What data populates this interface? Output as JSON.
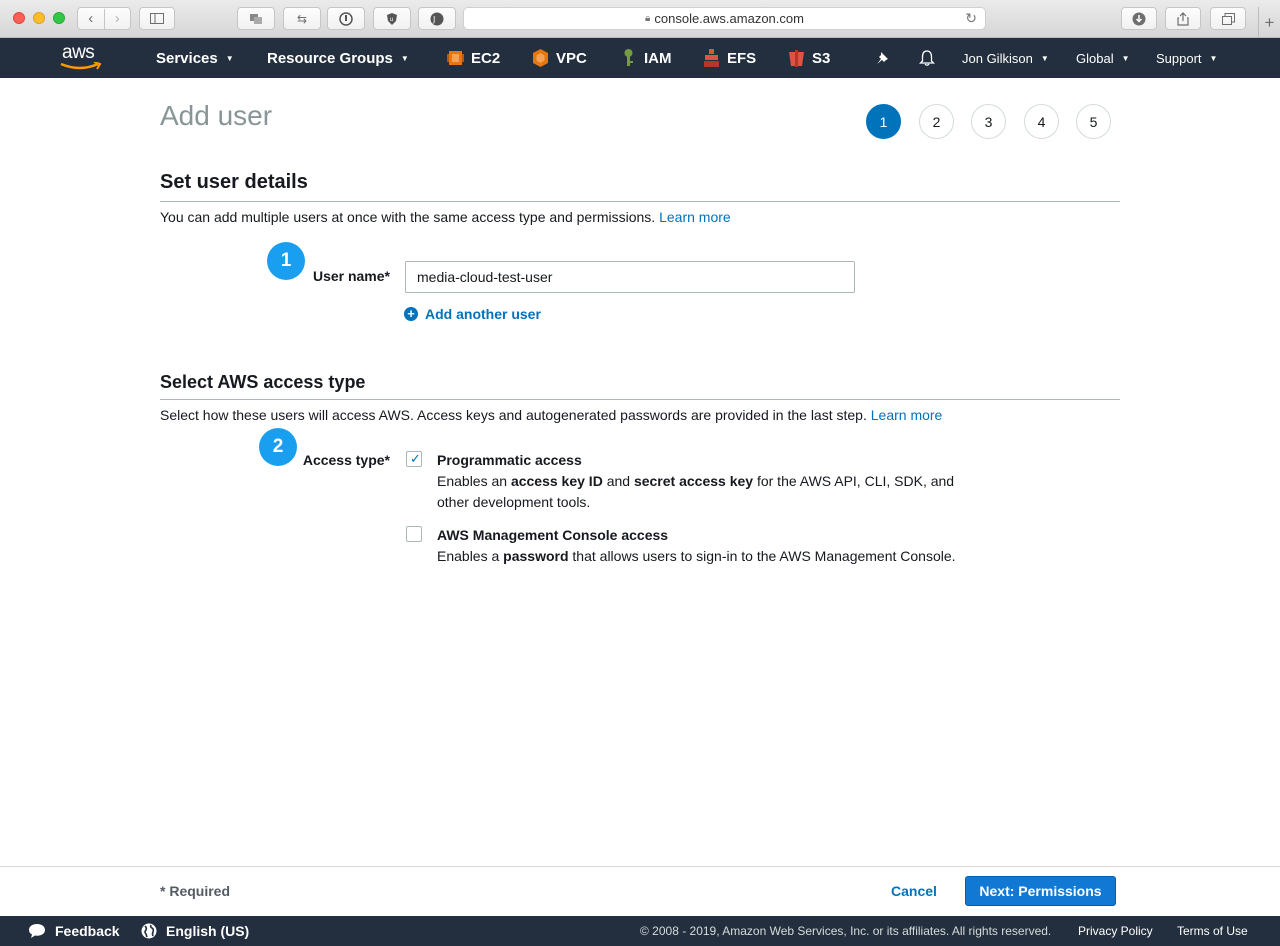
{
  "browser": {
    "url": "console.aws.amazon.com",
    "back_icon": "chevron-left-icon",
    "forward_icon": "chevron-right-icon"
  },
  "nav": {
    "logo": "aws",
    "services": "Services",
    "resource_groups": "Resource Groups",
    "shortcuts": [
      {
        "label": "EC2",
        "color": "#e8760f"
      },
      {
        "label": "VPC",
        "color": "#e8760f"
      },
      {
        "label": "IAM",
        "color": "#759c3e"
      },
      {
        "label": "EFS",
        "color": "#e05243"
      },
      {
        "label": "S3",
        "color": "#e05243"
      }
    ],
    "user": "Jon Gilkison",
    "region": "Global",
    "support": "Support"
  },
  "page": {
    "title": "Add user",
    "steps": [
      "1",
      "2",
      "3",
      "4",
      "5"
    ],
    "active_step": "1"
  },
  "details": {
    "title": "Set user details",
    "description": "You can add multiple users at once with the same access type and permissions.",
    "learn_more": "Learn more",
    "badge": "1",
    "user_name_label": "User name*",
    "user_name_value": "media-cloud-test-user",
    "add_another": "Add another user"
  },
  "access": {
    "title": "Select AWS access type",
    "description": "Select how these users will access AWS. Access keys and autogenerated passwords are provided in the last step.",
    "learn_more": "Learn more",
    "badge": "2",
    "access_type_label": "Access type*",
    "programmatic": {
      "title": "Programmatic access",
      "checked": true,
      "desc_a": "Enables an ",
      "desc_b": "access key ID",
      "desc_c": " and ",
      "desc_d": "secret access key",
      "desc_e": " for the AWS API, CLI, SDK, and other development tools."
    },
    "console": {
      "title": "AWS Management Console access",
      "checked": false,
      "desc_a": "Enables a ",
      "desc_b": "password",
      "desc_c": " that allows users to sign-in to the AWS Management Console."
    }
  },
  "actions": {
    "required": "* Required",
    "cancel": "Cancel",
    "next": "Next: Permissions"
  },
  "footer": {
    "feedback": "Feedback",
    "language": "English (US)",
    "copyright": "© 2008 - 2019, Amazon Web Services, Inc. or its affiliates. All rights reserved.",
    "privacy": "Privacy Policy",
    "terms": "Terms of Use"
  },
  "colors": {
    "nav_bg": "#232f3e",
    "accent": "#0073bb",
    "badge": "#1a9ff0"
  }
}
